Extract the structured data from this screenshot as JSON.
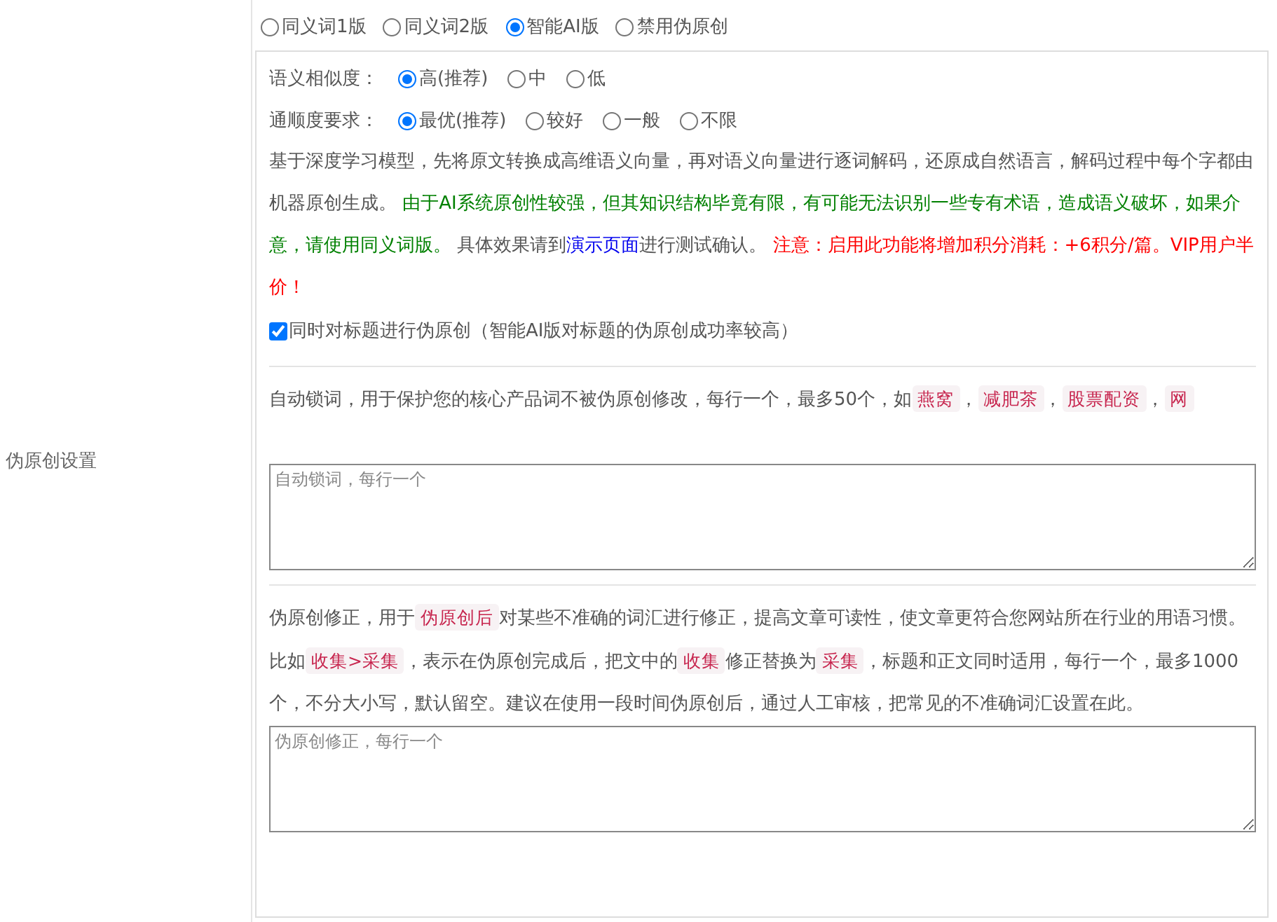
{
  "settings_label": "伪原创设置",
  "version_options": [
    {
      "label": "同义词1版",
      "selected": false
    },
    {
      "label": "同义词2版",
      "selected": false
    },
    {
      "label": "智能AI版",
      "selected": true
    },
    {
      "label": "禁用伪原创",
      "selected": false
    }
  ],
  "similarity": {
    "label": "语义相似度：",
    "options": [
      {
        "label": "高(推荐)",
        "selected": true
      },
      {
        "label": "中",
        "selected": false
      },
      {
        "label": "低",
        "selected": false
      }
    ]
  },
  "fluency": {
    "label": "通顺度要求：",
    "options": [
      {
        "label": "最优(推荐)",
        "selected": true
      },
      {
        "label": "较好",
        "selected": false
      },
      {
        "label": "一般",
        "selected": false
      },
      {
        "label": "不限",
        "selected": false
      }
    ]
  },
  "ai_description": [
    {
      "kind": "text",
      "text": "基于深度学习模型，先将原文转换成高维语义向量，再对语义向量进行逐词解码，还原成自然语言，解码过程中每个字都由机器原创生成。 "
    },
    {
      "kind": "green",
      "text": "由于AI系统原创性较强，但其知识结构毕竟有限，有可能无法识别一些专有术语，造成语义破坏，如果介意，请使用同义词版。"
    },
    {
      "kind": "text",
      "text": " 具体效果请到"
    },
    {
      "kind": "link",
      "text": "演示页面"
    },
    {
      "kind": "text",
      "text": "进行测试确认。 "
    },
    {
      "kind": "red",
      "text": "注意：启用此功能将增加积分消耗：+6积分/篇。VIP用户半价！"
    }
  ],
  "title_option": {
    "label": "同时对标题进行伪原创（智能AI版对标题的伪原创成功率较高）",
    "checked": true
  },
  "lock_words": {
    "description": [
      {
        "kind": "text",
        "text": "自动锁词，用于保护您的核心产品词不被伪原创修改，每行一个，最多50个，如"
      },
      {
        "kind": "tag",
        "text": "燕窝"
      },
      {
        "kind": "text",
        "text": "，"
      },
      {
        "kind": "tag",
        "text": "减肥茶"
      },
      {
        "kind": "text",
        "text": "，"
      },
      {
        "kind": "tag",
        "text": "股票配资"
      },
      {
        "kind": "text",
        "text": "，"
      },
      {
        "kind": "tag",
        "text": "网"
      }
    ],
    "placeholder": "自动锁词，每行一个"
  },
  "correction": {
    "description": [
      {
        "kind": "text",
        "text": "伪原创修正，用于"
      },
      {
        "kind": "tag",
        "text": "伪原创后"
      },
      {
        "kind": "text",
        "text": "对某些不准确的词汇进行修正，提高文章可读性，使文章更符合您网站所在行业的用语习惯。比如"
      },
      {
        "kind": "tag",
        "text": "收集>采集"
      },
      {
        "kind": "text",
        "text": "，表示在伪原创完成后，把文中的"
      },
      {
        "kind": "tag",
        "text": "收集"
      },
      {
        "kind": "text",
        "text": "修正替换为"
      },
      {
        "kind": "tag",
        "text": "采集"
      },
      {
        "kind": "text",
        "text": "，标题和正文同时适用，每行一个，最多1000个，不分大小写，默认留空。建议在使用一段时间伪原创后，通过人工审核，把常见的不准确词汇设置在此。"
      }
    ],
    "placeholder": "伪原创修正，每行一个"
  }
}
